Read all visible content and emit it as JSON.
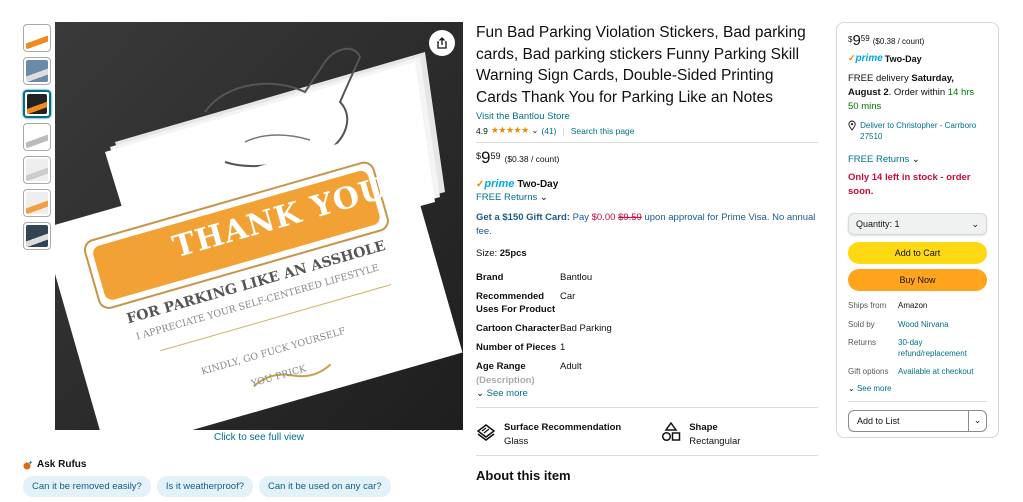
{
  "gallery": {
    "thumbnails": [
      {
        "name": "thumb-1",
        "colors": [
          "#ffffff",
          "#f08a1c"
        ]
      },
      {
        "name": "thumb-2",
        "colors": [
          "#6b8aa8",
          "#dddddd"
        ]
      },
      {
        "name": "thumb-3",
        "colors": [
          "#222222",
          "#f08a1c"
        ]
      },
      {
        "name": "thumb-4",
        "colors": [
          "#ffffff",
          "#bbbbbb"
        ]
      },
      {
        "name": "thumb-5",
        "colors": [
          "#eeeeee",
          "#cccccc"
        ]
      },
      {
        "name": "thumb-6",
        "colors": [
          "#eeeeee",
          "#f0a040"
        ]
      },
      {
        "name": "thumb-7",
        "colors": [
          "#334455",
          "#dddddd"
        ]
      }
    ],
    "card_text": {
      "headline": "THANK YOU",
      "line1": "FOR PARKING LIKE AN ASSHOLE",
      "line2": "I APPRECIATE YOUR SELF-CENTERED LIFESTYLE",
      "line3": "KINDLY, GO FUCK YOURSELF",
      "line4": "YOU PRICK"
    },
    "click_full_view": "Click to see full view"
  },
  "rufus": {
    "label": "Ask Rufus",
    "chips": [
      "Can it be removed easily?",
      "Is it weatherproof?",
      "Can it be used on any car?"
    ]
  },
  "product": {
    "title": "Fun Bad Parking Violation Stickers, Bad parking cards, Bad parking stickers Funny Parking Skill Warning Sign Cards, Double-Sided Printing Cards Thank You for Parking Like an Notes",
    "store": "Visit the Bantlou Store",
    "rating": "4.9",
    "stars": "★★★★★",
    "rating_count": "(41)",
    "search_page": "Search this page",
    "price_symbol": "$",
    "price_whole": "9",
    "price_fraction": "59",
    "price_unit": "($0.38 / count)",
    "prime_check": "✓",
    "prime_word": "prime",
    "prime_speed": "Two-Day",
    "free_returns": "FREE Returns",
    "gift_prefix": "Get a $150 Gift Card:",
    "gift_pay": " Pay ",
    "gift_new_price": "$0.00",
    "gift_old_price": "$9.59",
    "gift_suffix": " upon approval for Prime Visa. No annual fee.",
    "size_label": "Size: ",
    "size_value": "25pcs",
    "specs": [
      {
        "k": "Brand",
        "v": "Bantlou"
      },
      {
        "k": "Recommended Uses For Product",
        "v": "Car"
      },
      {
        "k": "Cartoon Character",
        "v": "Bad Parking"
      },
      {
        "k": "Number of Pieces",
        "v": "1"
      },
      {
        "k": "Age Range",
        "v": "Adult"
      }
    ],
    "spec_fade": "(Description)",
    "see_more": "See more",
    "features": [
      {
        "title": "Surface Recommendation",
        "value": "Glass",
        "icon": "surface-icon"
      },
      {
        "title": "Shape",
        "value": "Rectangular",
        "icon": "shape-icon"
      }
    ],
    "about": "About this item"
  },
  "buybox": {
    "price_symbol": "$",
    "price_whole": "9",
    "price_fraction": "59",
    "price_unit": "($0.38 / count)",
    "prime_check": "✓",
    "prime_word": "prime",
    "prime_speed": "Two-Day",
    "delivery_prefix": "FREE delivery ",
    "delivery_date": "Saturday, August 2",
    "order_within": ". Order within ",
    "countdown": "14 hrs 50 mins",
    "deliver_to": "Deliver to Christopher - Carrboro 27510",
    "free_returns": "FREE Returns",
    "stock": "Only 14 left in stock - order soon.",
    "quantity": "Quantity: 1",
    "add_to_cart": "Add to Cart",
    "buy_now": "Buy Now",
    "ship_info": [
      {
        "k": "Ships from",
        "v": "Amazon",
        "link": false
      },
      {
        "k": "Sold by",
        "v": "Wood Nirvana",
        "link": true
      },
      {
        "k": "Returns",
        "v": "30-day refund/replacement",
        "link": true
      },
      {
        "k": "Gift options",
        "v": "Available at checkout",
        "link": true
      }
    ],
    "see_more": "See more",
    "add_to_list": "Add to List"
  },
  "colors": {
    "link": "#007185",
    "price_red": "#cc0c39",
    "cart_yellow": "#ffd814",
    "buy_orange": "#ffa41c",
    "prime_blue": "#00a8e1"
  }
}
